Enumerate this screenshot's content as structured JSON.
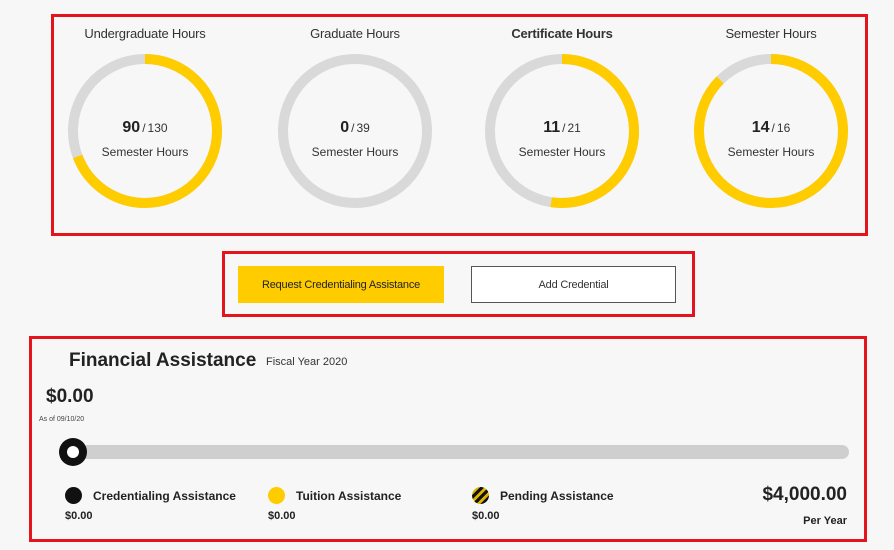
{
  "hours": {
    "gauges": [
      {
        "title": "Undergraduate Hours",
        "value": "90",
        "sep": "/",
        "max": "130",
        "unit": "Semester Hours",
        "fraction": 0.6923
      },
      {
        "title": "Graduate Hours",
        "value": "0",
        "sep": "/",
        "max": "39",
        "unit": "Semester Hours",
        "fraction": 0
      },
      {
        "title": "Certificate Hours",
        "value": "11",
        "sep": "/",
        "max": "21",
        "unit": "Semester Hours",
        "fraction": 0.5238
      },
      {
        "title": "Semester Hours",
        "value": "14",
        "sep": "/",
        "max": "16",
        "unit": "Semester Hours",
        "fraction": 0.875
      }
    ]
  },
  "actions": {
    "request_label": "Request Credentialing Assistance",
    "add_label": "Add Credential"
  },
  "financial": {
    "title": "Financial Assistance",
    "fiscal_year": "Fiscal Year 2020",
    "amount": "$0.00",
    "as_of": "As of 09/10/20",
    "progress": 0,
    "legend": [
      {
        "label": "Credentialing Assistance",
        "value": "$0.00",
        "color": "#111111"
      },
      {
        "label": "Tuition Assistance",
        "value": "$0.00",
        "color": "#ffcc00"
      },
      {
        "label": "Pending Assistance",
        "value": "$0.00",
        "color": "hatched-yellow-black"
      }
    ],
    "total": "$4,000.00",
    "per": "Per Year"
  },
  "colors": {
    "accent": "#ffcc00",
    "track": "#d9d9d9",
    "highlight_border": "#e3141b"
  }
}
